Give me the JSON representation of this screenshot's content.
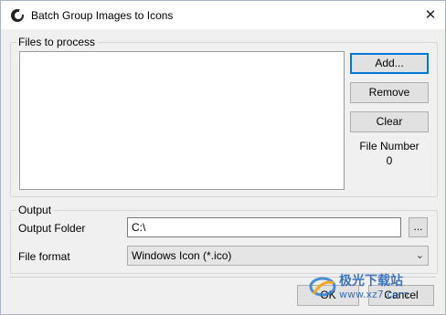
{
  "window": {
    "title": "Batch Group Images to Icons",
    "close_glyph": "✕"
  },
  "files": {
    "group_label": "Files to process",
    "add_label": "Add...",
    "remove_label": "Remove",
    "clear_label": "Clear",
    "file_number_label": "File Number",
    "file_number_value": "0"
  },
  "output": {
    "group_label": "Output",
    "folder_label": "Output Folder",
    "folder_value": "C:\\",
    "browse_label": "...",
    "format_label": "File format",
    "format_value": "Windows Icon (*.ico)"
  },
  "footer": {
    "ok_label": "OK",
    "cancel_label": "Cancel"
  },
  "watermark": {
    "text": "极光下载站",
    "url": "www.xz7.com"
  }
}
